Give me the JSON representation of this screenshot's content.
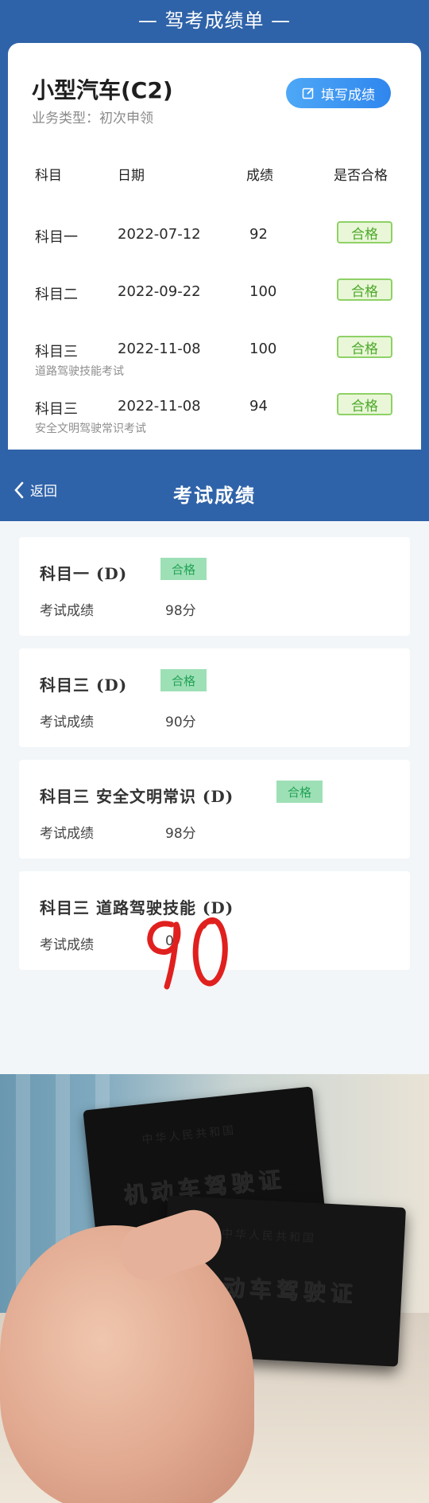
{
  "report": {
    "title": "— 驾考成绩单 —",
    "license_type": "小型汽车(C2)",
    "business_type": "业务类型：初次申领",
    "fill_button_label": "填写成绩",
    "headers": [
      "科目",
      "日期",
      "成绩",
      "是否合格"
    ],
    "rows": [
      {
        "subject": "科目一",
        "date": "2022-07-12",
        "score": "92",
        "result": "合格",
        "note": ""
      },
      {
        "subject": "科目二",
        "date": "2022-09-22",
        "score": "100",
        "result": "合格",
        "note": ""
      },
      {
        "subject": "科目三",
        "date": "2022-11-08",
        "score": "100",
        "result": "合格",
        "note": "道路驾驶技能考试"
      },
      {
        "subject": "科目三",
        "date": "2022-11-08",
        "score": "94",
        "result": "合格",
        "note": "安全文明驾驶常识考试"
      }
    ]
  },
  "exam_results": {
    "back_label": "返回",
    "title": "考试成绩",
    "score_label": "考试成绩",
    "cards": [
      {
        "title": "科目一 (D)",
        "badge": "合格",
        "score": "98分"
      },
      {
        "title": "科目三 (D)",
        "badge": "合格",
        "score": "90分"
      },
      {
        "title": "科目三 安全文明常识 (D)",
        "badge": "合格",
        "score": "98分"
      },
      {
        "title": "科目三 道路驾驶技能 (D)",
        "badge": "",
        "score": "0"
      }
    ],
    "handwritten": "90"
  },
  "photo": {
    "book_top_text": "中华人民共和国",
    "book_cover_text": "机动车驾驶证"
  },
  "colors": {
    "header_blue": "#2f63a9",
    "pass_green": "#4da82a",
    "badge_green": "#23a256",
    "scrawl_red": "#e0201e"
  }
}
